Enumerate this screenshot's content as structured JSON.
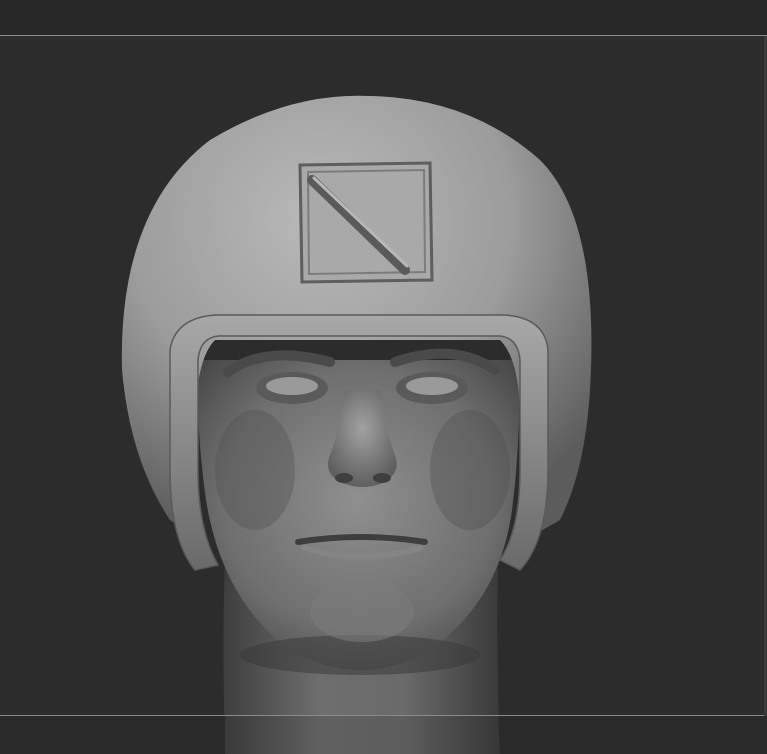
{
  "viewport": {
    "background": "#2c2c2c",
    "rule_color": "#8a8a8a"
  },
  "model": {
    "subject": "sculpted-head-with-helmet",
    "material_color": "#9a9a9a",
    "helmet_badge_icon": "diagonal-stripe-square-icon"
  }
}
